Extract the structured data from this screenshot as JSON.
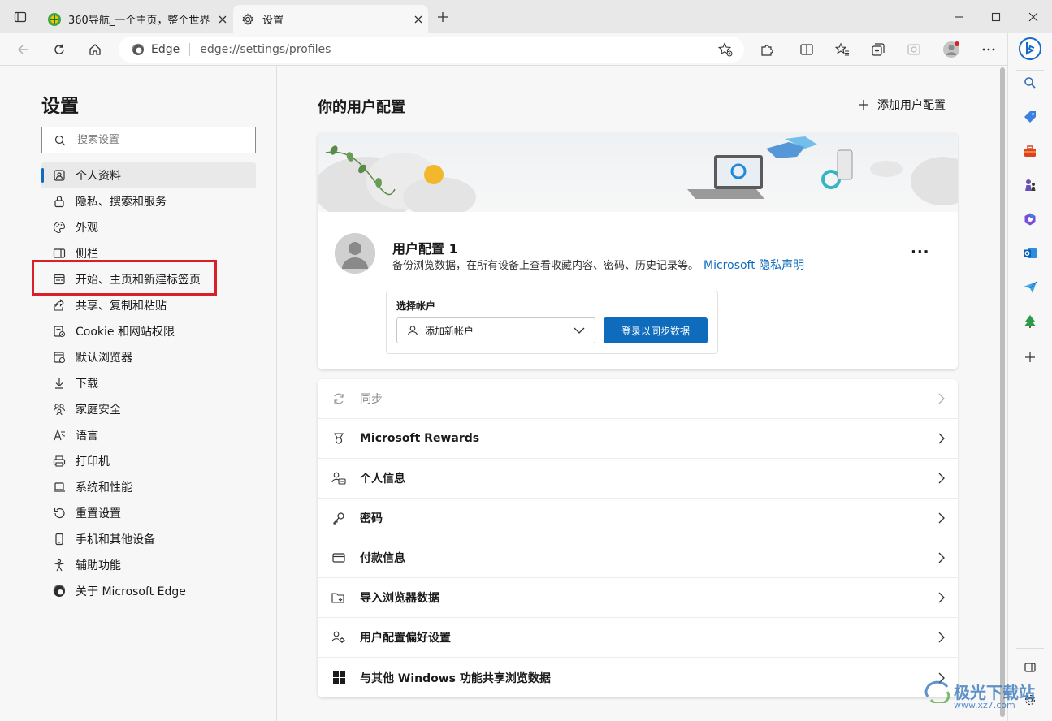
{
  "tabs": [
    {
      "title": "360导航_一个主页，整个世界",
      "active": false,
      "icon": "360-logo-icon"
    },
    {
      "title": "设置",
      "active": true,
      "icon": "gear-icon"
    }
  ],
  "address_bar": {
    "site_label": "Edge",
    "url": "edge://settings/profiles"
  },
  "settings_nav": {
    "title": "设置",
    "search_placeholder": "搜索设置",
    "items": [
      {
        "label": "个人资料",
        "icon": "profile-icon",
        "active": true
      },
      {
        "label": "隐私、搜索和服务",
        "icon": "lock-icon"
      },
      {
        "label": "外观",
        "icon": "palette-icon"
      },
      {
        "label": "侧栏",
        "icon": "sidebar-icon"
      },
      {
        "label": "开始、主页和新建标签页",
        "icon": "home-tab-icon"
      },
      {
        "label": "共享、复制和粘贴",
        "icon": "share-icon"
      },
      {
        "label": "Cookie 和网站权限",
        "icon": "cookie-icon"
      },
      {
        "label": "默认浏览器",
        "icon": "browser-icon"
      },
      {
        "label": "下载",
        "icon": "download-icon"
      },
      {
        "label": "家庭安全",
        "icon": "family-icon"
      },
      {
        "label": "语言",
        "icon": "language-icon"
      },
      {
        "label": "打印机",
        "icon": "printer-icon"
      },
      {
        "label": "系统和性能",
        "icon": "laptop-icon"
      },
      {
        "label": "重置设置",
        "icon": "reset-icon"
      },
      {
        "label": "手机和其他设备",
        "icon": "phone-icon"
      },
      {
        "label": "辅助功能",
        "icon": "accessibility-icon"
      },
      {
        "label": "关于 Microsoft Edge",
        "icon": "edge-logo-icon"
      }
    ]
  },
  "main": {
    "title": "你的用户配置",
    "add_profile": "添加用户配置",
    "profile": {
      "name": "用户配置 1",
      "description": "备份浏览数据，在所有设备上查看收藏内容、密码、历史记录等。",
      "privacy_link": "Microsoft 隐私声明",
      "more": "···"
    },
    "account": {
      "label": "选择帐户",
      "select_value": "添加新帐户",
      "signin_button": "登录以同步数据"
    },
    "rows": [
      {
        "label": "同步",
        "icon": "sync-icon",
        "disabled": true
      },
      {
        "label": "Microsoft Rewards",
        "icon": "rewards-icon"
      },
      {
        "label": "个人信息",
        "icon": "personal-info-icon"
      },
      {
        "label": "密码",
        "icon": "key-icon"
      },
      {
        "label": "付款信息",
        "icon": "card-icon"
      },
      {
        "label": "导入浏览器数据",
        "icon": "import-icon"
      },
      {
        "label": "用户配置偏好设置",
        "icon": "profile-prefs-icon"
      },
      {
        "label": "与其他 Windows 功能共享浏览数据",
        "icon": "windows-icon"
      }
    ]
  },
  "watermark": {
    "text": "极光下载站",
    "sub": "www.xz7.com"
  },
  "colors": {
    "accent": "#0f6cbd",
    "highlight": "#d9202a"
  }
}
